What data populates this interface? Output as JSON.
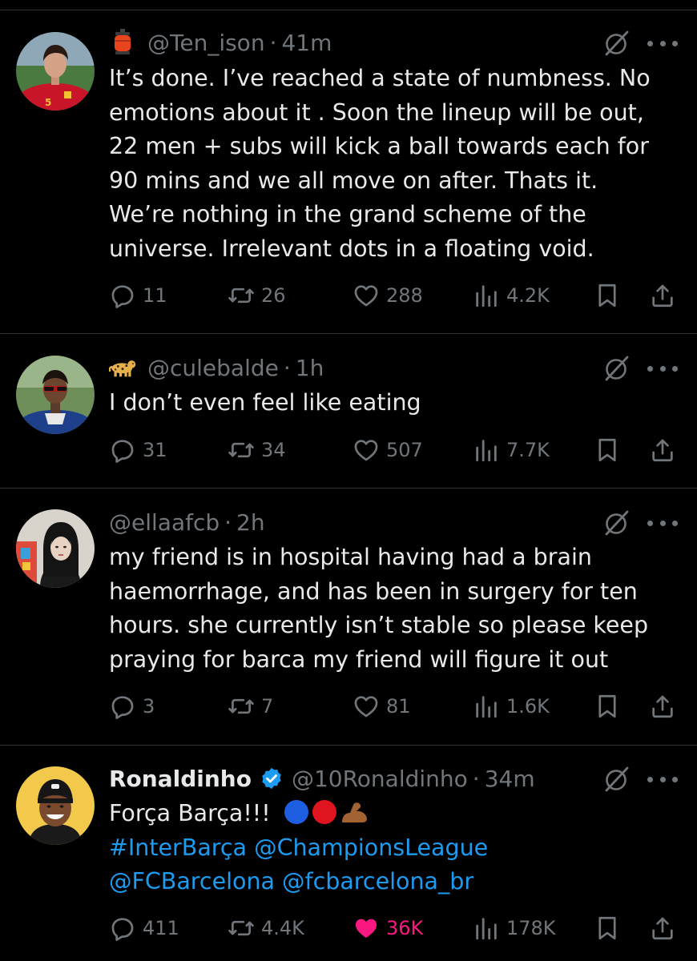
{
  "colors": {
    "background": "#000000",
    "text": "#e7e9ea",
    "muted": "#71767b",
    "link": "#1d9bf0",
    "like_active": "#f91880",
    "verified": "#1d9bf0",
    "divider": "#2f3336"
  },
  "tweets": [
    {
      "display_name": "",
      "emoji": "lantern-emoji",
      "handle": "@Ten_ison",
      "time": "41m",
      "lines": [
        "It’s done. I’ve reached a state of numbness. No",
        "emotions about it . Soon the lineup will be out,",
        "22 men + subs will kick a ball towards each  for",
        "90 mins and we all move on after. Thats it.",
        "We’re nothing in the grand scheme of the",
        "universe. Irrelevant dots in a floating void."
      ],
      "replies": "11",
      "reposts": "26",
      "likes": "288",
      "views": "4.2K",
      "liked": false
    },
    {
      "display_name": "",
      "emoji": "leopard-emoji",
      "handle": "@culebalde",
      "time": "1h",
      "lines": [
        "I don’t even feel like eating"
      ],
      "replies": "31",
      "reposts": "34",
      "likes": "507",
      "views": "7.7K",
      "liked": false
    },
    {
      "display_name": "",
      "emoji": "",
      "handle": "@ellaafcb",
      "time": "2h",
      "lines": [
        "my friend is in hospital having had a brain",
        "haemorrhage, and has been in surgery for ten",
        "hours. she currently isn’t stable so please keep",
        "praying for barca my friend will figure it out"
      ],
      "replies": "3",
      "reposts": "7",
      "likes": "81",
      "views": "1.6K",
      "liked": false
    },
    {
      "display_name": "Ronaldinho",
      "verified": true,
      "handle": "@10Ronaldinho",
      "time": "34m",
      "text": "Força Barça!!!",
      "text_emojis": [
        "blue-circle-emoji",
        "red-circle-emoji",
        "flexed-biceps-emoji"
      ],
      "link_lines": [
        "#InterBarça @ChampionsLeague",
        "@FCBarcelona @fcbarcelona_br"
      ],
      "replies": "411",
      "reposts": "4.4K",
      "likes": "36K",
      "views": "178K",
      "liked": true
    }
  ]
}
